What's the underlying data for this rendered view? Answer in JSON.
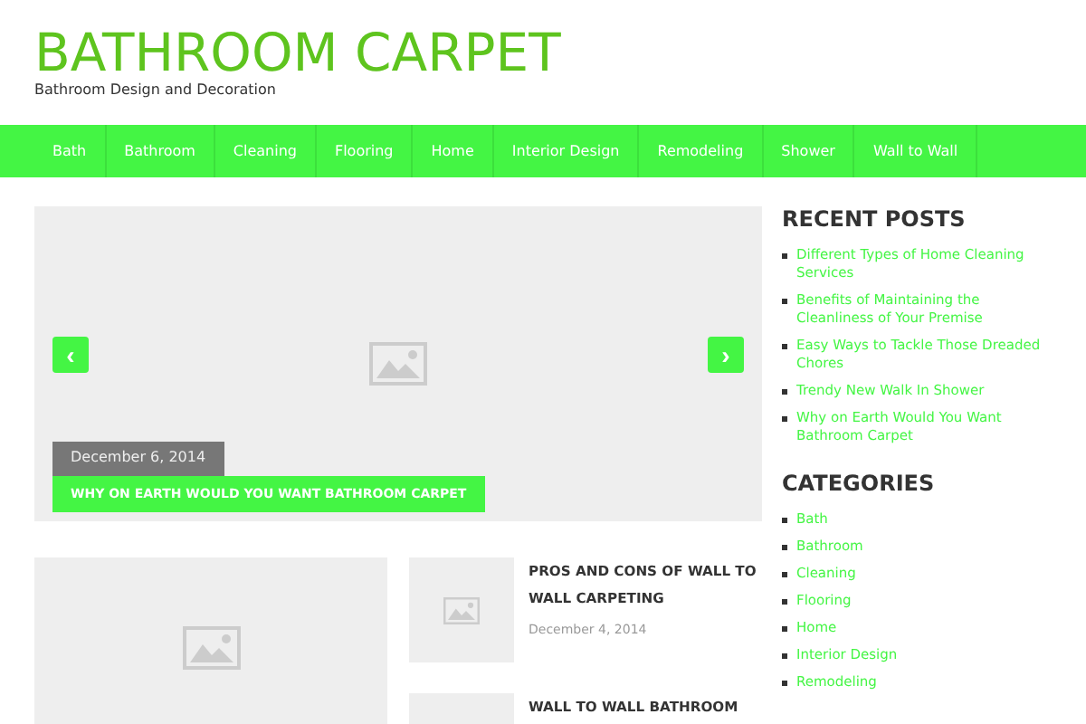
{
  "site": {
    "title": "BATHROOM CARPET",
    "tagline": "Bathroom Design and Decoration"
  },
  "nav": [
    "Bath",
    "Bathroom",
    "Cleaning",
    "Flooring",
    "Home",
    "Interior Design",
    "Remodeling",
    "Shower",
    "Wall to Wall"
  ],
  "slider": {
    "prev": "‹",
    "next": "›",
    "date": "December 6, 2014",
    "title": "WHY ON EARTH WOULD YOU WANT BATHROOM CARPET"
  },
  "posts": [
    {
      "title": "PROS AND CONS OF WALL TO WALL CARPETING",
      "date": "December 4, 2014"
    },
    {
      "title": "WALL TO WALL BATHROOM"
    }
  ],
  "sidebar": {
    "recent_title": "RECENT POSTS",
    "recent": [
      "Different Types of Home Cleaning Services",
      "Benefits of Maintaining the Cleanliness of Your Premise",
      "Easy Ways to Tackle Those Dreaded Chores",
      "Trendy New Walk In Shower",
      "Why on Earth Would You Want Bathroom Carpet"
    ],
    "categories_title": "CATEGORIES",
    "categories": [
      "Bath",
      "Bathroom",
      "Cleaning",
      "Flooring",
      "Home",
      "Interior Design",
      "Remodeling"
    ]
  }
}
